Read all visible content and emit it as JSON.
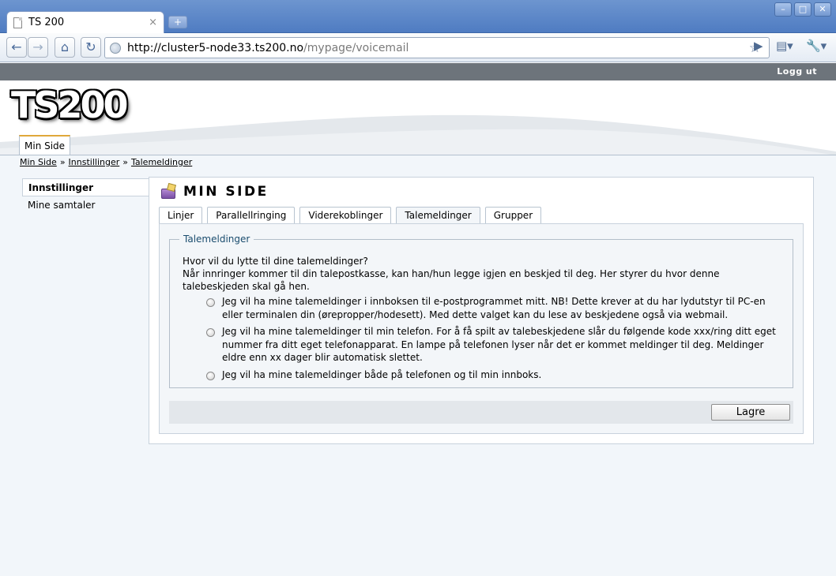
{
  "browser": {
    "tab_title": "TS 200",
    "tab_close": "×",
    "new_tab": "+",
    "url_host": "http://cluster5-node33.ts200.no",
    "url_path": "/mypage/voicemail",
    "window_buttons": [
      "–",
      "□",
      "✕"
    ]
  },
  "site": {
    "logout": "Logg ut",
    "logo": "TS200",
    "main_nav": "Min Side",
    "breadcrumb": [
      "Min Side",
      "Innstillinger",
      "Talemeldinger"
    ],
    "breadcrumb_sep": "»"
  },
  "sidebar": {
    "items": [
      {
        "label": "Innstillinger",
        "active": true
      },
      {
        "label": "Mine samtaler",
        "active": false
      }
    ]
  },
  "content": {
    "title": "MIN SIDE",
    "tabs": [
      "Linjer",
      "Parallellringing",
      "Viderekoblinger",
      "Talemeldinger",
      "Grupper"
    ],
    "active_tab": "Talemeldinger",
    "fieldset_legend": "Talemeldinger",
    "question": "Hvor vil du lytte til dine talemeldinger?",
    "description": "Når innringer kommer til din talepostkasse, kan han/hun legge igjen en beskjed til deg. Her styrer du hvor denne talebeskjeden skal gå hen.",
    "options": [
      "Jeg vil ha mine talemeldinger i innboksen til e-postprogrammet mitt. NB! Dette krever at du har lydutstyr til PC-en eller terminalen din (ørepropper/hodesett). Med dette valget kan du lese av beskjedene også via webmail.",
      "Jeg vil ha mine talemeldinger til min telefon. For å få spilt av talebeskjedene slår du følgende kode xxx/ring ditt eget nummer fra ditt eget telefonapparat. En lampe på telefonen lyser når det er kommet meldinger til deg. Meldinger eldre enn xx dager blir automatisk slettet.",
      "Jeg vil ha mine talemeldinger både på telefonen og til min innboks."
    ],
    "save_label": "Lagre"
  },
  "colors": {
    "title_bar": "#5a86c8",
    "user_bar": "#6d747b",
    "nav_accent": "#e0a83a",
    "legend_text": "#1a4c6e"
  }
}
